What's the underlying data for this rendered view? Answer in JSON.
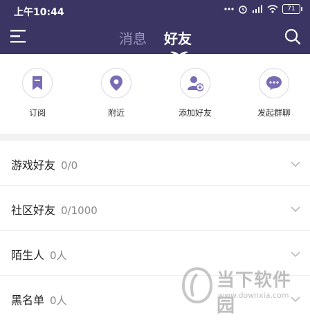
{
  "status_bar": {
    "time": "上午10:44",
    "battery": "71"
  },
  "nav": {
    "tabs": [
      {
        "label": "消息",
        "active": false
      },
      {
        "label": "好友",
        "active": true
      }
    ]
  },
  "quick_actions": [
    {
      "label": "订阅",
      "icon": "bookmark-icon"
    },
    {
      "label": "附近",
      "icon": "location-pin-icon"
    },
    {
      "label": "添加好友",
      "icon": "add-user-icon"
    },
    {
      "label": "发起群聊",
      "icon": "chat-bubble-icon"
    }
  ],
  "groups": [
    {
      "name": "游戏好友",
      "count": "0/0"
    },
    {
      "name": "社区好友",
      "count": "0/1000"
    },
    {
      "name": "陌生人",
      "count": "0人"
    },
    {
      "name": "黑名单",
      "count": "0人"
    }
  ],
  "watermark": {
    "title": "当下软件园",
    "url": "www.downxia.com"
  },
  "colors": {
    "header_bg": "#3a3563",
    "accent": "#7a6bb5"
  }
}
